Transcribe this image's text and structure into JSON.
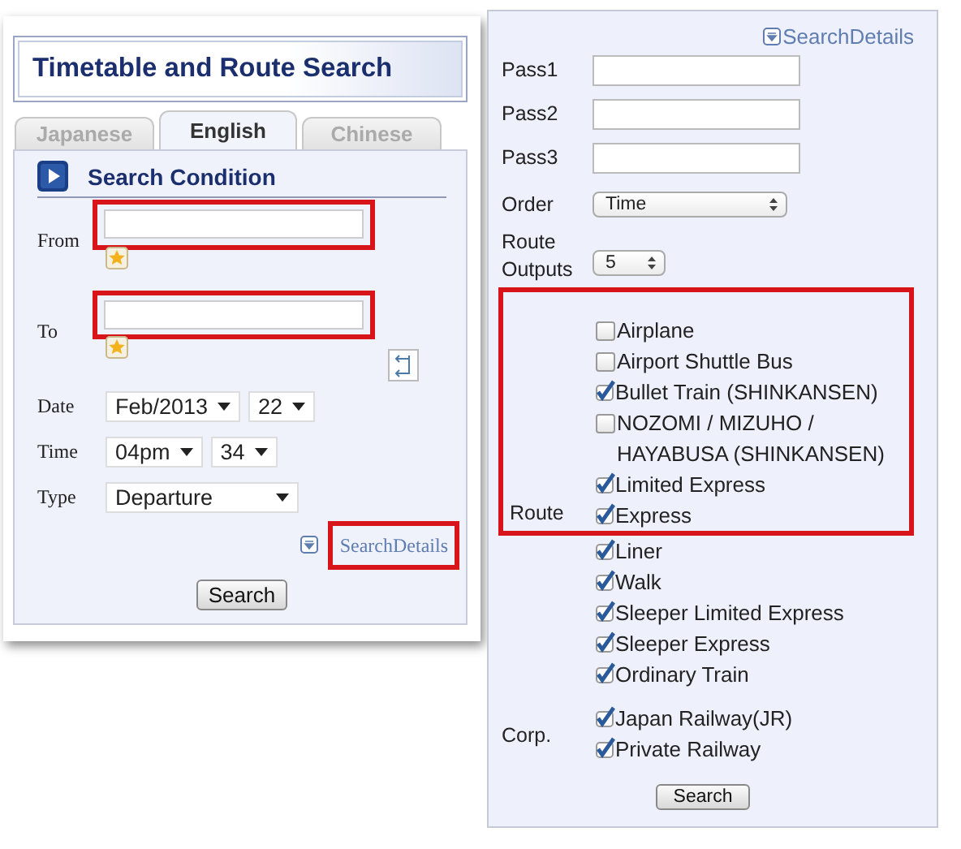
{
  "left_panel": {
    "title": "Timetable and Route Search",
    "tabs": [
      {
        "label": "Japanese",
        "selected": false
      },
      {
        "label": "English",
        "selected": true
      },
      {
        "label": "Chinese",
        "selected": false
      }
    ],
    "heading": "Search Condition",
    "from": {
      "label": "From",
      "highlighted": true
    },
    "to": {
      "label": "To",
      "highlighted": true
    },
    "date": {
      "label": "Date",
      "selects": [
        "Feb/2013",
        "22"
      ]
    },
    "time": {
      "label": "Time",
      "selects": [
        "04pm",
        "34"
      ]
    },
    "type": {
      "label": "Type",
      "selects": [
        "Departure"
      ]
    },
    "details_link": {
      "label": "SearchDetails",
      "highlighted": true
    },
    "search_button": "Search"
  },
  "right_panel": {
    "details_link": "SearchDetails",
    "passes": [
      {
        "label": "Pass1"
      },
      {
        "label": "Pass2"
      },
      {
        "label": "Pass3"
      }
    ],
    "order": {
      "label": "Order",
      "value": "Time"
    },
    "route_outputs": {
      "label": "Route Outputs",
      "value": "5"
    },
    "route": {
      "label": "Route",
      "highlighted": true,
      "framed_options": [
        {
          "label": "Airplane",
          "checked": false
        },
        {
          "label": "Airport Shuttle Bus",
          "checked": false
        },
        {
          "label": "Bullet Train (SHINKANSEN)",
          "checked": true
        },
        {
          "label": "NOZOMI / MIZUHO / HAYABUSA (SHINKANSEN)",
          "checked": false
        },
        {
          "label": "Limited Express",
          "checked": true
        },
        {
          "label": "Express",
          "checked": true
        }
      ],
      "more_options": [
        {
          "label": "Liner",
          "checked": true
        },
        {
          "label": "Walk",
          "checked": true
        },
        {
          "label": "Sleeper Limited Express",
          "checked": true
        },
        {
          "label": "Sleeper Express",
          "checked": true
        },
        {
          "label": "Ordinary Train",
          "checked": true
        }
      ]
    },
    "corp": {
      "label": "Corp.",
      "options": [
        {
          "label": "Japan Railway(JR)",
          "checked": true
        },
        {
          "label": "Private Railway",
          "checked": true
        }
      ]
    },
    "search_button": "Search"
  }
}
